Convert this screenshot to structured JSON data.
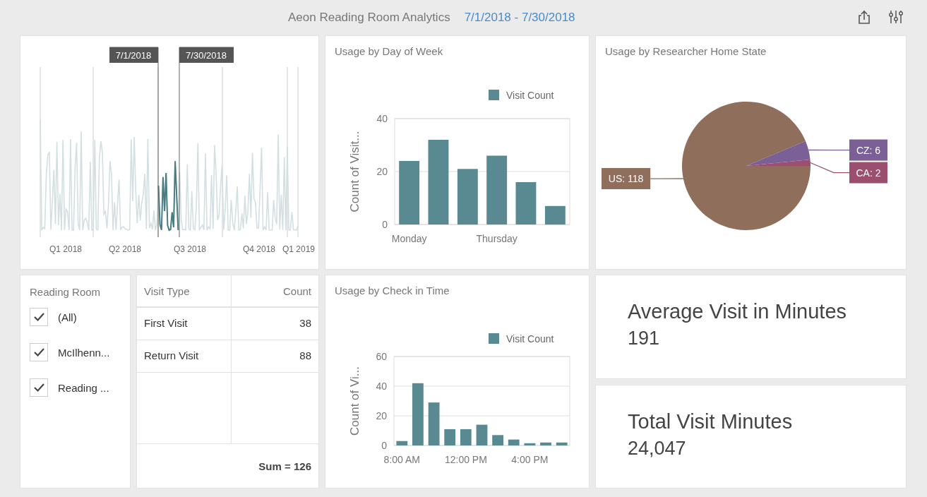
{
  "header": {
    "title": "Aeon Reading Room Analytics",
    "date_range": "7/1/2018 - 7/30/2018"
  },
  "timeline": {
    "range_start": "7/1/2018",
    "range_end": "7/30/2018",
    "axis_labels": [
      "Q1 2018",
      "Q2 2018",
      "Q3 2018",
      "Q4 2018",
      "Q1 2019"
    ]
  },
  "day_of_week": {
    "title": "Usage by Day of Week",
    "chart_data": {
      "type": "bar",
      "ylabel": "Count of Visit...",
      "categories": [
        "Monday",
        null,
        null,
        "Thursday",
        null,
        null
      ],
      "ylim": [
        0,
        40
      ],
      "yticks": [
        0,
        20,
        40
      ],
      "series": [
        {
          "name": "Visit Count",
          "color": "#5a8a91",
          "values": [
            24,
            32,
            21,
            26,
            16,
            7
          ]
        }
      ]
    }
  },
  "home_state": {
    "title": "Usage by Researcher Home State",
    "chart_data": {
      "type": "pie",
      "values": [
        118,
        6,
        2
      ],
      "colors": [
        "#8f6e5c",
        "#7b6097",
        "#9a4f6e"
      ],
      "value_labels": [
        "US: 118",
        "CZ: 6",
        "CA: 2"
      ]
    }
  },
  "reading_room": {
    "title": "Reading Room",
    "items": [
      {
        "label": "(All)",
        "checked": true
      },
      {
        "label": "McIlhenn...",
        "checked": true
      },
      {
        "label": "Reading ...",
        "checked": true
      }
    ]
  },
  "visit_types": {
    "columns": [
      "Visit Type",
      "Count"
    ],
    "rows": [
      [
        "First Visit",
        "38"
      ],
      [
        "Return Visit",
        "88"
      ]
    ],
    "total": "Sum = 126"
  },
  "check_in_time": {
    "title": "Usage by Check in Time",
    "chart_data": {
      "type": "bar",
      "ylabel": "Count of Vi...",
      "x": [
        8,
        9,
        10,
        11,
        12,
        13,
        14,
        15,
        16,
        17,
        18
      ],
      "xlim": [
        7.5,
        18.5
      ],
      "xticks": [
        {
          "value": 8,
          "label": "8:00 AM"
        },
        {
          "value": 12,
          "label": "12:00 PM"
        },
        {
          "value": 16,
          "label": "4:00 PM"
        }
      ],
      "ylim": [
        0,
        60
      ],
      "yticks": [
        0,
        20,
        40,
        60
      ],
      "series": [
        {
          "name": "Visit Count",
          "color": "#5a8a91",
          "values": [
            3,
            42,
            29,
            11,
            11,
            14,
            7,
            4,
            1.5,
            2,
            2
          ]
        }
      ]
    }
  },
  "kpis": [
    {
      "label": "Average Visit in Minutes",
      "value": "191"
    },
    {
      "label": "Total Visit Minutes",
      "value": "24,047"
    }
  ]
}
